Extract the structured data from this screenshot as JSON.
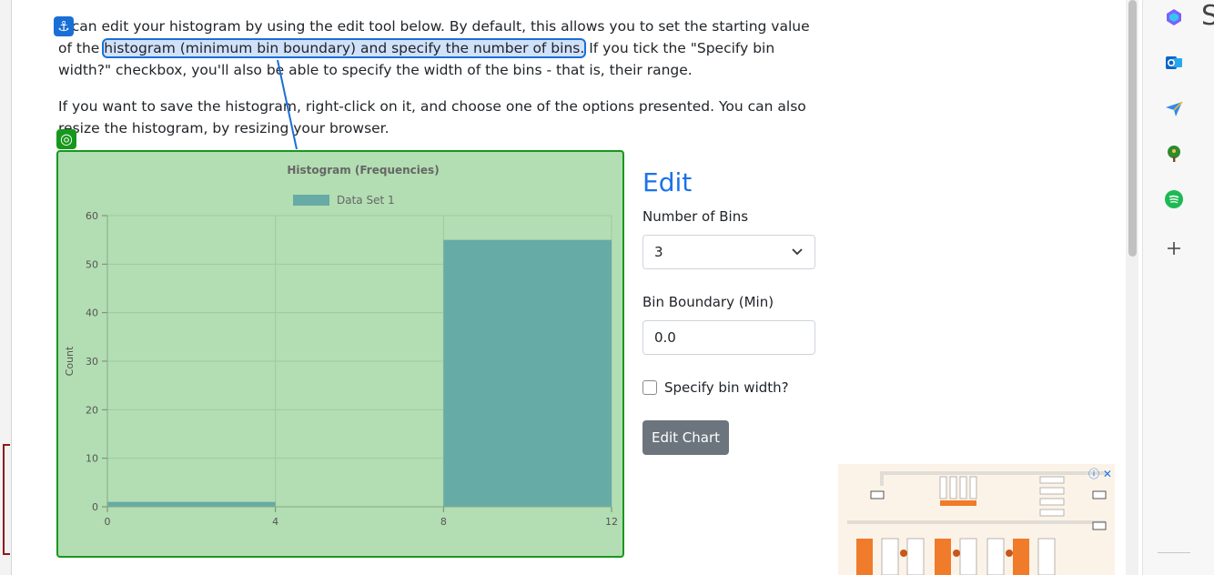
{
  "content": {
    "p1_pre": "u can edit your histogram by using the edit tool below. By default, this allows you to set the starting value of the",
    "p1_highlight": "histogram (minimum bin boundary) and specify the number of bins.",
    "p1_post": " If you tick the \"Specify bin width?\" checkbox, you'll also be able to specify the width of the bins - that is, their range.",
    "p2": "If you want to save the histogram, right-click on it, and choose one of the options presented. You can also resize the histogram, by resizing your browser."
  },
  "chart_data": {
    "type": "bar",
    "title": "Histogram (Frequencies)",
    "legend": [
      "Data Set 1"
    ],
    "xlabel": "",
    "ylabel": "Count",
    "x_ticks": [
      0,
      4,
      8,
      12
    ],
    "y_ticks": [
      0,
      10,
      20,
      30,
      40,
      50,
      60
    ],
    "ylim": [
      0,
      60
    ],
    "xlim": [
      0,
      12
    ],
    "bins": [
      {
        "start": 0,
        "end": 4,
        "value": 1
      },
      {
        "start": 4,
        "end": 8,
        "value": 0
      },
      {
        "start": 8,
        "end": 12,
        "value": 55
      }
    ],
    "colors": {
      "bar": "#66aba5",
      "background": "#b3ddb2",
      "grid": "#9fca9e"
    }
  },
  "edit": {
    "title": "Edit",
    "bins_label": "Number of Bins",
    "bins_value": "3",
    "min_label": "Bin Boundary (Min)",
    "min_value": "0.0",
    "width_checkbox_label": "Specify bin width?",
    "button_label": "Edit Chart"
  },
  "overlay": {
    "anchor_icon": "⚓",
    "target_icon": "◎"
  },
  "ad": {
    "choices": "ⓘ ✕"
  },
  "sidebar": {
    "icons": [
      "copilot-icon",
      "outlook-icon",
      "send-icon",
      "tree-icon",
      "spotify-icon",
      "add-icon"
    ],
    "add_glyph": "+"
  },
  "edge_glyph": "S"
}
